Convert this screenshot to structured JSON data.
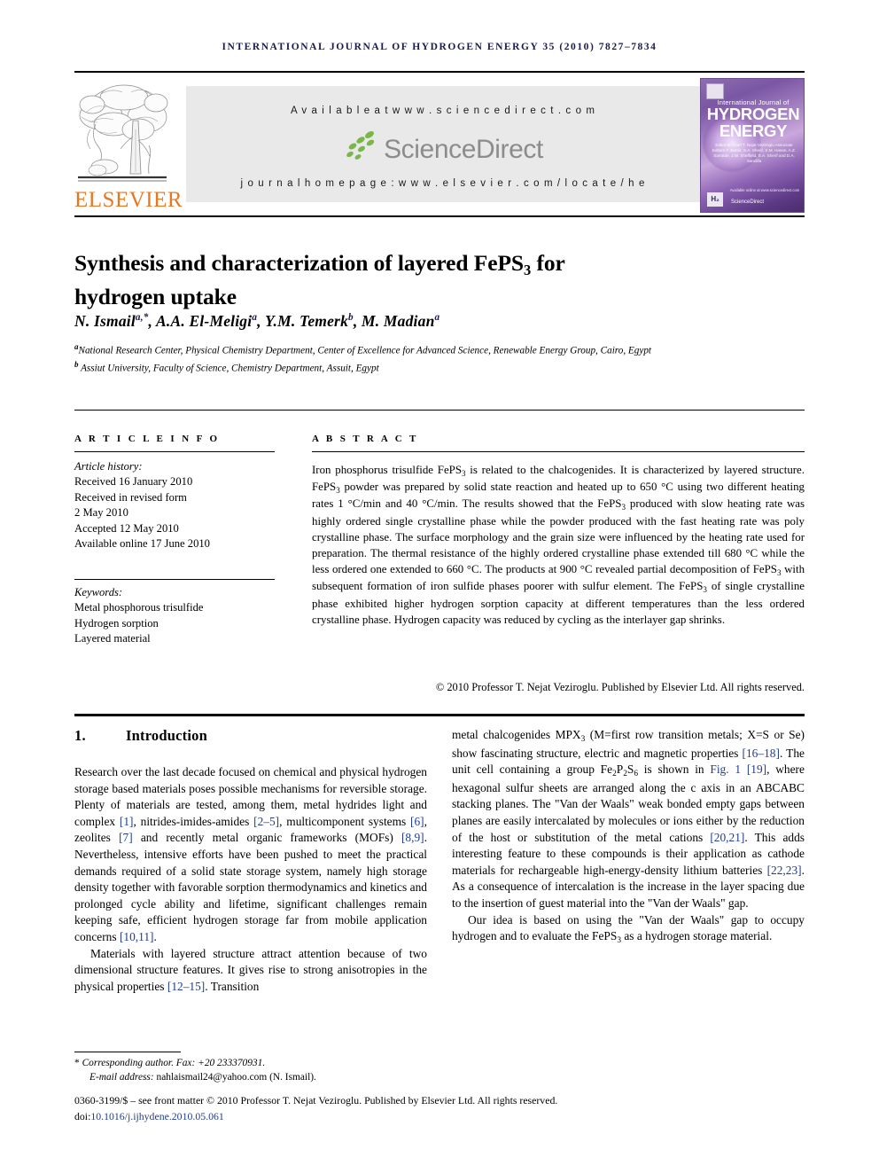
{
  "running_head": "International Journal of Hydrogen Energy 35 (2010) 7827–7834",
  "masthead": {
    "publisher_logo_word": "ELSEVIER",
    "available_at": "A v a i l a b l e   a t   w w w . s c i e n c e d i r e c t . c o m",
    "sciencedirect_name": "ScienceDirect",
    "journal_homepage": "j o u r n a l   h o m e p a g e :   w w w . e l s e v i e r . c o m / l o c a t e / h e",
    "cover": {
      "small_title": "International Journal of",
      "big_title_line1": "HYDROGEN",
      "big_title_line2": "ENERGY",
      "editors": "Editor-in-Chief  T. Nejat Veziroglu    Associate Editors  F. Barbir, S.A. Sherif, S.M. Hasan, A.Z. Sarralde, J.W. Sheffield, S.A. Sherif and D.A. Sandilla",
      "h2_mark": "H₂",
      "sciencedirect_mark": "ScienceDirect",
      "sd_caption": "Available online at www.sciencedirect.com"
    }
  },
  "article": {
    "title_line1": "Synthesis and characterization of layered FePS",
    "title_sub": "3",
    "title_line1_tail": " for",
    "title_line2": "hydrogen uptake",
    "authors": [
      {
        "name": "N. Ismail",
        "sup": "a,*"
      },
      {
        "name": "A.A. El-Meligi",
        "sup": "a"
      },
      {
        "name": "Y.M. Temerk",
        "sup": "b"
      },
      {
        "name": "M. Madian",
        "sup": "a"
      }
    ],
    "affiliations": [
      {
        "marker": "a",
        "text": "National Research Center, Physical Chemistry Department, Center of Excellence for Advanced Science, Renewable Energy Group, Cairo, Egypt"
      },
      {
        "marker": "b",
        "text": "Assiut University, Faculty of Science, Chemistry Department, Assuit, Egypt"
      }
    ]
  },
  "sections": {
    "article_info_label": "A R T I C L E   I N F O",
    "abstract_label": "A B S T R A C T"
  },
  "article_history": {
    "heading": "Article history:",
    "lines": [
      "Received 16 January 2010",
      "Received in revised form",
      "2 May 2010",
      "Accepted 12 May 2010",
      "Available online 17 June 2010"
    ]
  },
  "keywords": {
    "heading": "Keywords:",
    "items": [
      "Metal phosphorous trisulfide",
      "Hydrogen sorption",
      "Layered material"
    ]
  },
  "abstract": {
    "text_parts": [
      "Iron phosphorus trisulfide FePS",
      "3",
      " is related to the chalcogenides. It is characterized by layered structure. FePS",
      "3",
      " powder was prepared by solid state reaction and heated up to 650 °C using two different heating rates 1 °C/min and 40 °C/min. The results showed that the FePS",
      "3",
      " produced with slow heating rate was highly ordered single crystalline phase while the powder produced with the fast heating rate was poly crystalline phase. The surface morphology and the grain size were influenced by the heating rate used for preparation. The thermal resistance of the highly ordered crystalline phase extended till 680 °C while the less ordered one extended to 660 °C. The products at 900 °C revealed partial decomposition of FePS",
      "3",
      " with subsequent formation of iron sulfide phases poorer with sulfur element. The FePS",
      "3",
      " of single crystalline phase exhibited higher hydrogen sorption capacity at different temperatures than the less ordered crystalline phase. Hydrogen capacity was reduced by cycling as the interlayer gap shrinks."
    ],
    "copyright": "© 2010 Professor T. Nejat Veziroglu. Published by Elsevier Ltd. All rights reserved."
  },
  "introduction": {
    "number": "1.",
    "heading": "Introduction",
    "left_p1": "Research over the last decade focused on chemical and physical hydrogen storage based materials poses possible mechanisms for reversible storage. Plenty of materials are tested, among them, metal hydrides light and complex [1], nitrides-imides-amides [2–5], multicomponent systems [6], zeolites [7] and recently metal organic frameworks (MOFs) [8,9]. Nevertheless, intensive efforts have been pushed to meet the practical demands required of a solid state storage system, namely high storage density together with favorable sorption thermodynamics and kinetics and prolonged cycle ability and lifetime, significant challenges remain keeping safe, efficient hydrogen storage far from mobile application concerns [10,11].",
    "left_p2": "Materials with layered structure attract attention because of two dimensional structure features. It gives rise to strong anisotropies in the physical properties [12–15]. Transition",
    "right_p1": "metal chalcogenides MPX3 (M=first row transition metals; X=S or Se) show fascinating structure, electric and magnetic properties [16–18]. The unit cell containing a group Fe2P2S6 is shown in Fig. 1 [19], where hexagonal sulfur sheets are arranged along the c axis in an ABCABC stacking planes. The \"Van der Waals\" weak bonded empty gaps between planes are easily intercalated by molecules or ions either by the reduction of the host or substitution of the metal cations [20,21]. This adds interesting feature to these compounds is their application as cathode materials for rechargeable high-energy-density lithium batteries [22,23]. As a consequence of intercalation is the increase in the layer spacing due to the insertion of guest material into the \"Van der Waals\" gap.",
    "right_p2": "Our idea is based on using the \"Van der Waals\" gap to occupy hydrogen and to evaluate the FePS3 as a hydrogen storage material."
  },
  "footnotes": {
    "corresponding": "Corresponding author. Fax: +20 233370931.",
    "email_label": "E-mail address:",
    "email": "nahlaismail24@yahoo.com",
    "email_suffix": "(N. Ismail)."
  },
  "imprint": {
    "line1": "0360-3199/$ – see front matter © 2010 Professor T. Nejat Veziroglu. Published by Elsevier Ltd. All rights reserved.",
    "doi_label": "doi:",
    "doi": "10.1016/j.ijhydene.2010.05.061"
  },
  "colors": {
    "running_head": "#1a1a4e",
    "elsevier_orange": "#E87722",
    "reference_link": "#1f3d8f",
    "sciencedirect_grey": "#8c8c8c",
    "panel_grey": "#e9e9e9"
  }
}
